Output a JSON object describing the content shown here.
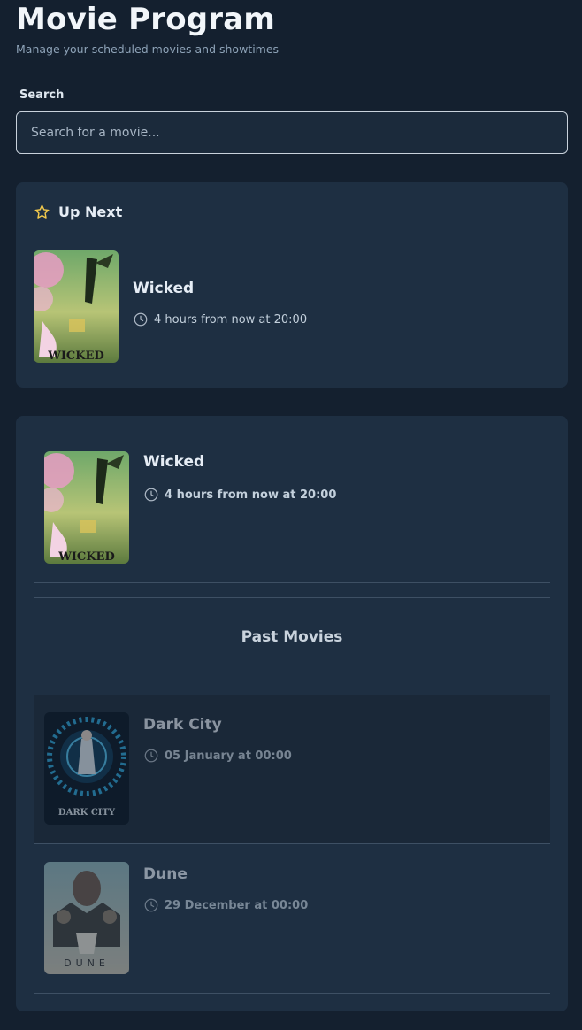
{
  "header": {
    "title": "Movie Program",
    "subtitle": "Manage your scheduled movies and showtimes"
  },
  "search": {
    "label": "Search",
    "placeholder": "Search for a movie...",
    "value": ""
  },
  "up_next": {
    "heading": "Up Next",
    "icon": "star-icon",
    "movie": {
      "title": "Wicked",
      "time": "4 hours from now at 20:00",
      "poster_text": "WICKED"
    }
  },
  "upcoming": [
    {
      "title": "Wicked",
      "time": "4 hours from now at 20:00",
      "poster_text": "WICKED"
    }
  ],
  "past": {
    "heading": "Past Movies",
    "movies": [
      {
        "title": "Dark City",
        "time": "05 January at 00:00",
        "poster_text": "DARK CITY"
      },
      {
        "title": "Dune",
        "time": "29 December at 00:00",
        "poster_text": "DUNE"
      }
    ]
  },
  "colors": {
    "background": "#14202f",
    "card": "#1e2f42",
    "star": "#f2c94c",
    "text": "#e6edf5"
  }
}
